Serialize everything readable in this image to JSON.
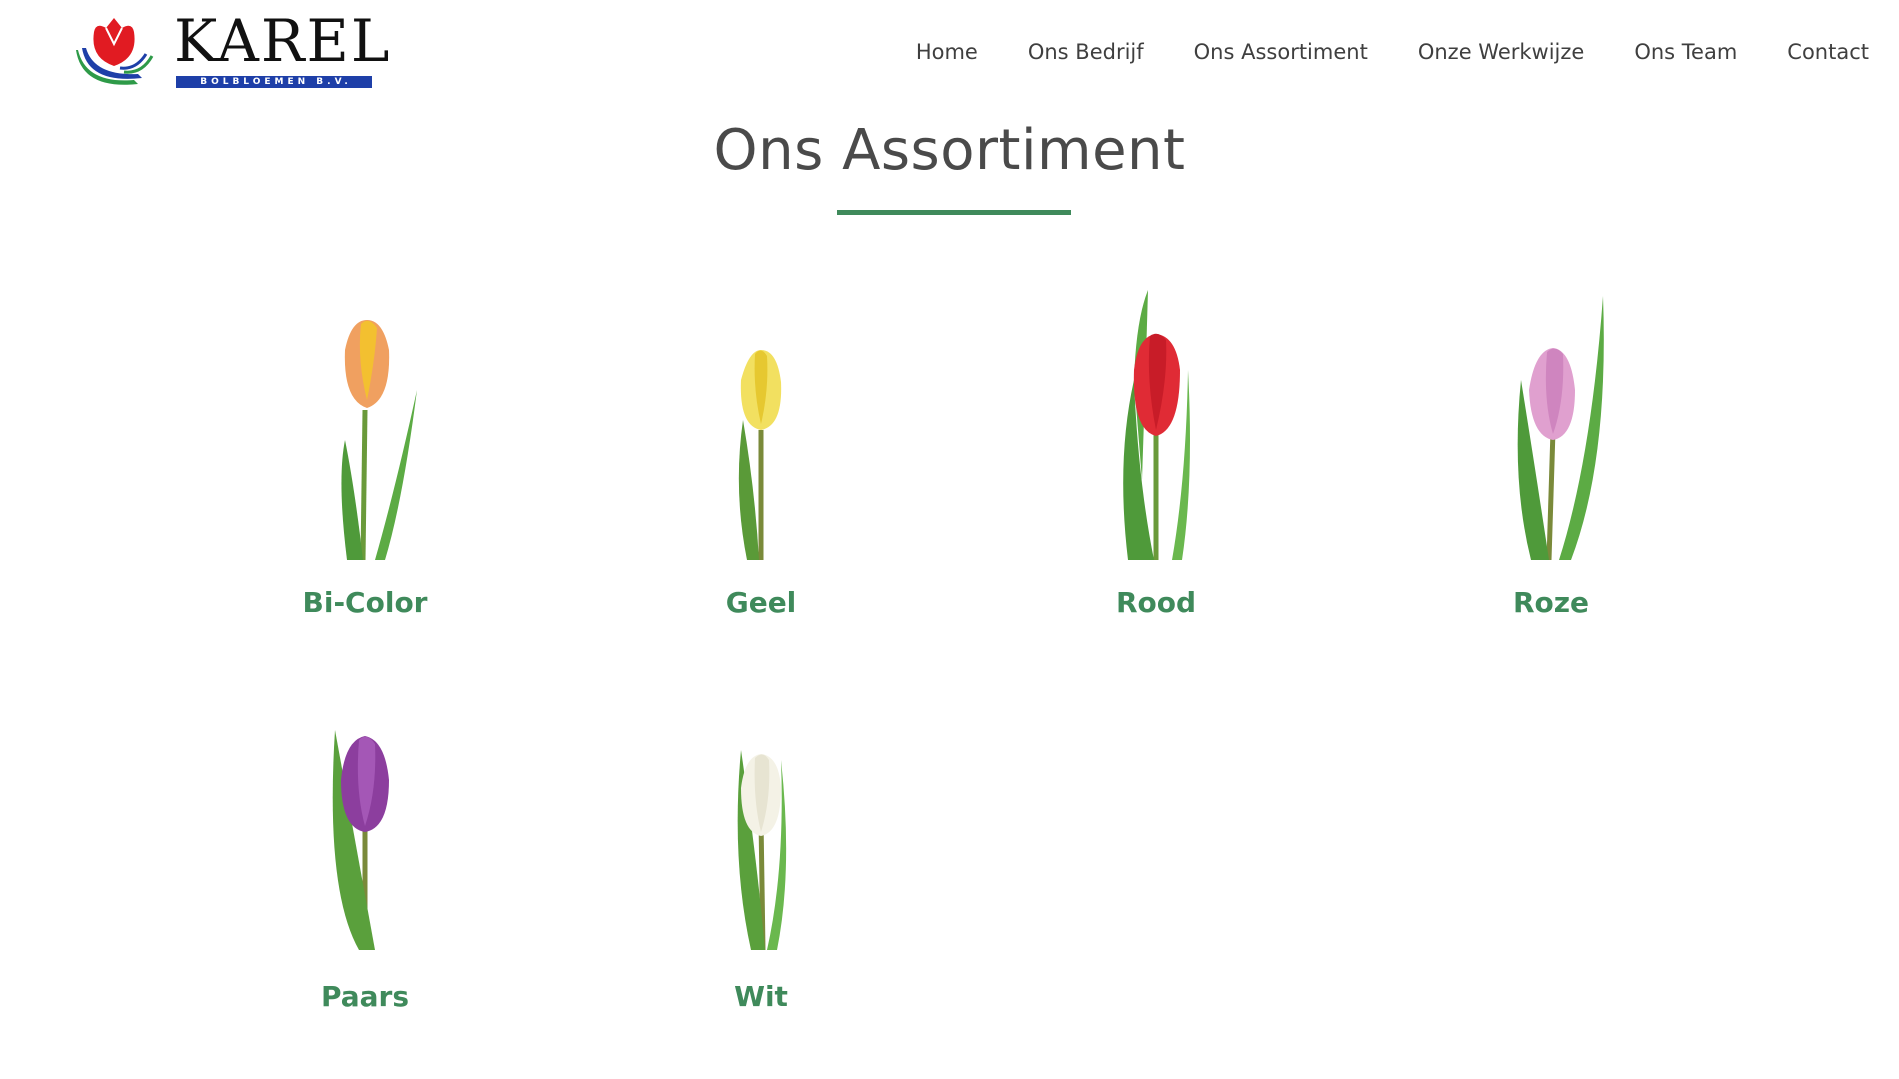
{
  "brand": {
    "name": "KAREL",
    "subtitle": "BOLBLOEMEN B.V."
  },
  "nav": {
    "items": [
      {
        "label": "Home"
      },
      {
        "label": "Ons Bedrijf"
      },
      {
        "label": "Ons Assortiment"
      },
      {
        "label": "Onze Werkwijze"
      },
      {
        "label": "Ons Team"
      },
      {
        "label": "Contact"
      }
    ]
  },
  "page": {
    "title": "Ons Assortiment"
  },
  "products": [
    {
      "label": "Bi-Color",
      "icon": "tulip-bicolor-image"
    },
    {
      "label": "Geel",
      "icon": "tulip-yellow-image"
    },
    {
      "label": "Rood",
      "icon": "tulip-red-image"
    },
    {
      "label": "Roze",
      "icon": "tulip-pink-image"
    },
    {
      "label": "Paars",
      "icon": "tulip-purple-image"
    },
    {
      "label": "Wit",
      "icon": "tulip-white-image"
    }
  ],
  "colors": {
    "accent": "#3f8a5b",
    "nav_text": "#3f3f3f",
    "title_text": "#4a4a4a",
    "logo_red": "#e11b22",
    "logo_blue": "#1e3fa8",
    "logo_green": "#2e9a48"
  }
}
